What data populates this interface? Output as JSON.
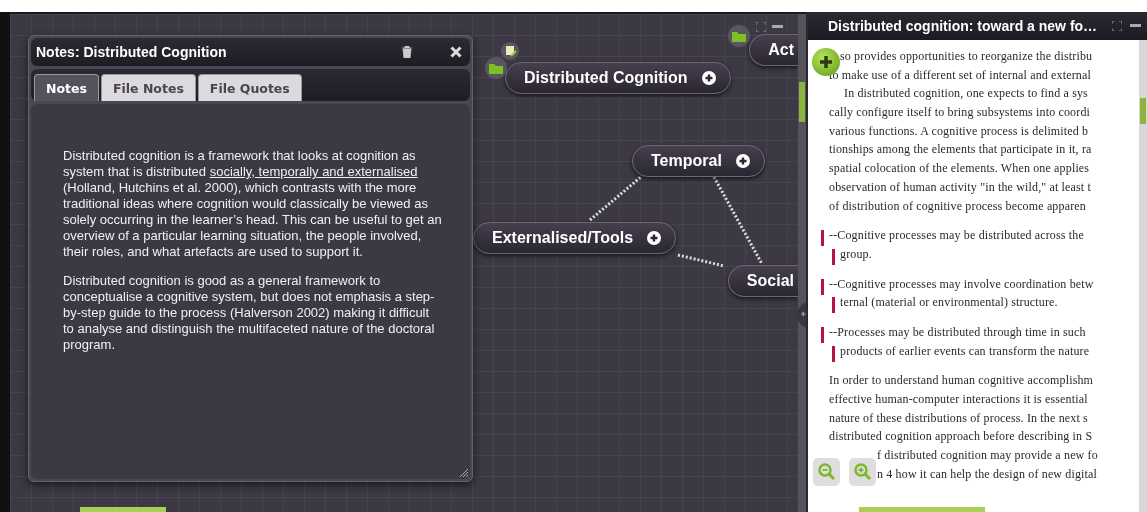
{
  "canvas": {
    "nodes": [
      {
        "label": "Act",
        "add_button": false
      },
      {
        "label": "Distributed Cognition",
        "add_button": true
      },
      {
        "label": "Temporal",
        "add_button": true
      },
      {
        "label": "Externalised/Tools",
        "add_button": true
      },
      {
        "label": "Social",
        "add_button": false
      }
    ]
  },
  "notes_window": {
    "title": "Notes: Distributed Cognition",
    "tabs": [
      {
        "label": "Notes",
        "selected": true
      },
      {
        "label": "File Notes",
        "selected": false
      },
      {
        "label": "File Quotes",
        "selected": false
      }
    ],
    "paragraphs": [
      [
        {
          "text": "Distributed cognition is a framework that looks at cognition as system that is distributed ",
          "underline": false
        },
        {
          "text": "socially, temporally and externalised ",
          "underline": true
        },
        {
          "text": "(Holland, Hutchins et al. 2000), which contrasts with the more traditional ideas where cognition would classically be viewed as solely occurring in the learner’s head. This can be useful to get an overview of a particular learning situation, the people involved, their roles, and what artefacts are used to support it.",
          "underline": false
        }
      ],
      [
        {
          "text": "Distributed cognition is good as a general framework to conceptualise a cognitive system, but does not emphasis a step-by-step guide to the process (Halverson 2002) making it difficult to analyse and distinguish the multifaceted nature of the doctoral program.",
          "underline": false
        }
      ]
    ]
  },
  "document": {
    "title": "Distributed cognition: toward a new fo…",
    "lines": [
      {
        "text": "so provides opportunities to reorganize the distribu",
        "kind": "after-button",
        "gap_before": false
      },
      {
        "text": "to make use of a different set of internal and external",
        "kind": "text",
        "gap_before": false
      },
      {
        "text": "In distributed cognition, one expects to find a sys",
        "kind": "para",
        "gap_before": false
      },
      {
        "text": "cally configure itself to bring subsystems into coordi",
        "kind": "text",
        "gap_before": false
      },
      {
        "text": "various functions. A cognitive process is delimited b",
        "kind": "text",
        "gap_before": false
      },
      {
        "text": "tionships among the elements that participate in it, ra",
        "kind": "text",
        "gap_before": false
      },
      {
        "text": "spatial colocation of the elements. When one applies",
        "kind": "text",
        "gap_before": false
      },
      {
        "text": "observation of human activity \"in the wild,\" at least t",
        "kind": "text",
        "gap_before": false
      },
      {
        "text": "of distribution of cognitive process become apparen",
        "kind": "text",
        "gap_before": false
      },
      {
        "text": "--Cognitive processes may be distributed across the",
        "kind": "quote-first",
        "gap_before": true
      },
      {
        "text": "group.",
        "kind": "quote-cont",
        "gap_before": false
      },
      {
        "text": "--Cognitive processes may involve coordination betw",
        "kind": "quote-first",
        "gap_before": true
      },
      {
        "text": "ternal (material or environmental) structure.",
        "kind": "quote-cont",
        "gap_before": false
      },
      {
        "text": "--Processes may be distributed through time in such",
        "kind": "quote-first",
        "gap_before": true
      },
      {
        "text": "products of earlier events can transform the nature",
        "kind": "quote-cont",
        "gap_before": false
      },
      {
        "text": "In order to understand human cognitive accomplishm",
        "kind": "text",
        "gap_before": true
      },
      {
        "text": "effective human-computer interactions it is essential",
        "kind": "text",
        "gap_before": false
      },
      {
        "text": "nature of these distributions of process. In the next s",
        "kind": "text",
        "gap_before": false
      },
      {
        "text": "distributed cognition approach before describing in S",
        "kind": "text",
        "gap_before": false
      },
      {
        "text": "f distributed cognition may provide a new fo",
        "kind": "after-zoom",
        "gap_before": false
      },
      {
        "text": "n 4 how it can help the design of new digital",
        "kind": "after-zoom",
        "gap_before": false
      }
    ]
  }
}
